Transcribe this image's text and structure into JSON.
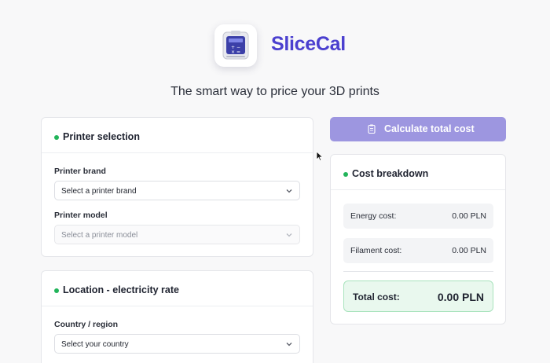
{
  "app": {
    "name": "SliceCal",
    "tagline": "The smart way to price your 3D prints",
    "brand_color": "#4b40cf"
  },
  "printer_selection": {
    "title": "Printer selection",
    "brand_label": "Printer brand",
    "brand_value": "Select a printer brand",
    "model_label": "Printer model",
    "model_value": "Select a printer model"
  },
  "location": {
    "title": "Location - electricity rate",
    "country_label": "Country / region",
    "country_value": "Select your country"
  },
  "calculate": {
    "label": "Calculate total cost",
    "icon": "clipboard-icon",
    "color": "#9d96e0"
  },
  "breakdown": {
    "title": "Cost breakdown",
    "energy_label": "Energy cost:",
    "energy_value": "0.00 PLN",
    "filament_label": "Filament cost:",
    "filament_value": "0.00 PLN",
    "total_label": "Total cost:",
    "total_value": "0.00 PLN",
    "accent_color": "#22b45a"
  }
}
